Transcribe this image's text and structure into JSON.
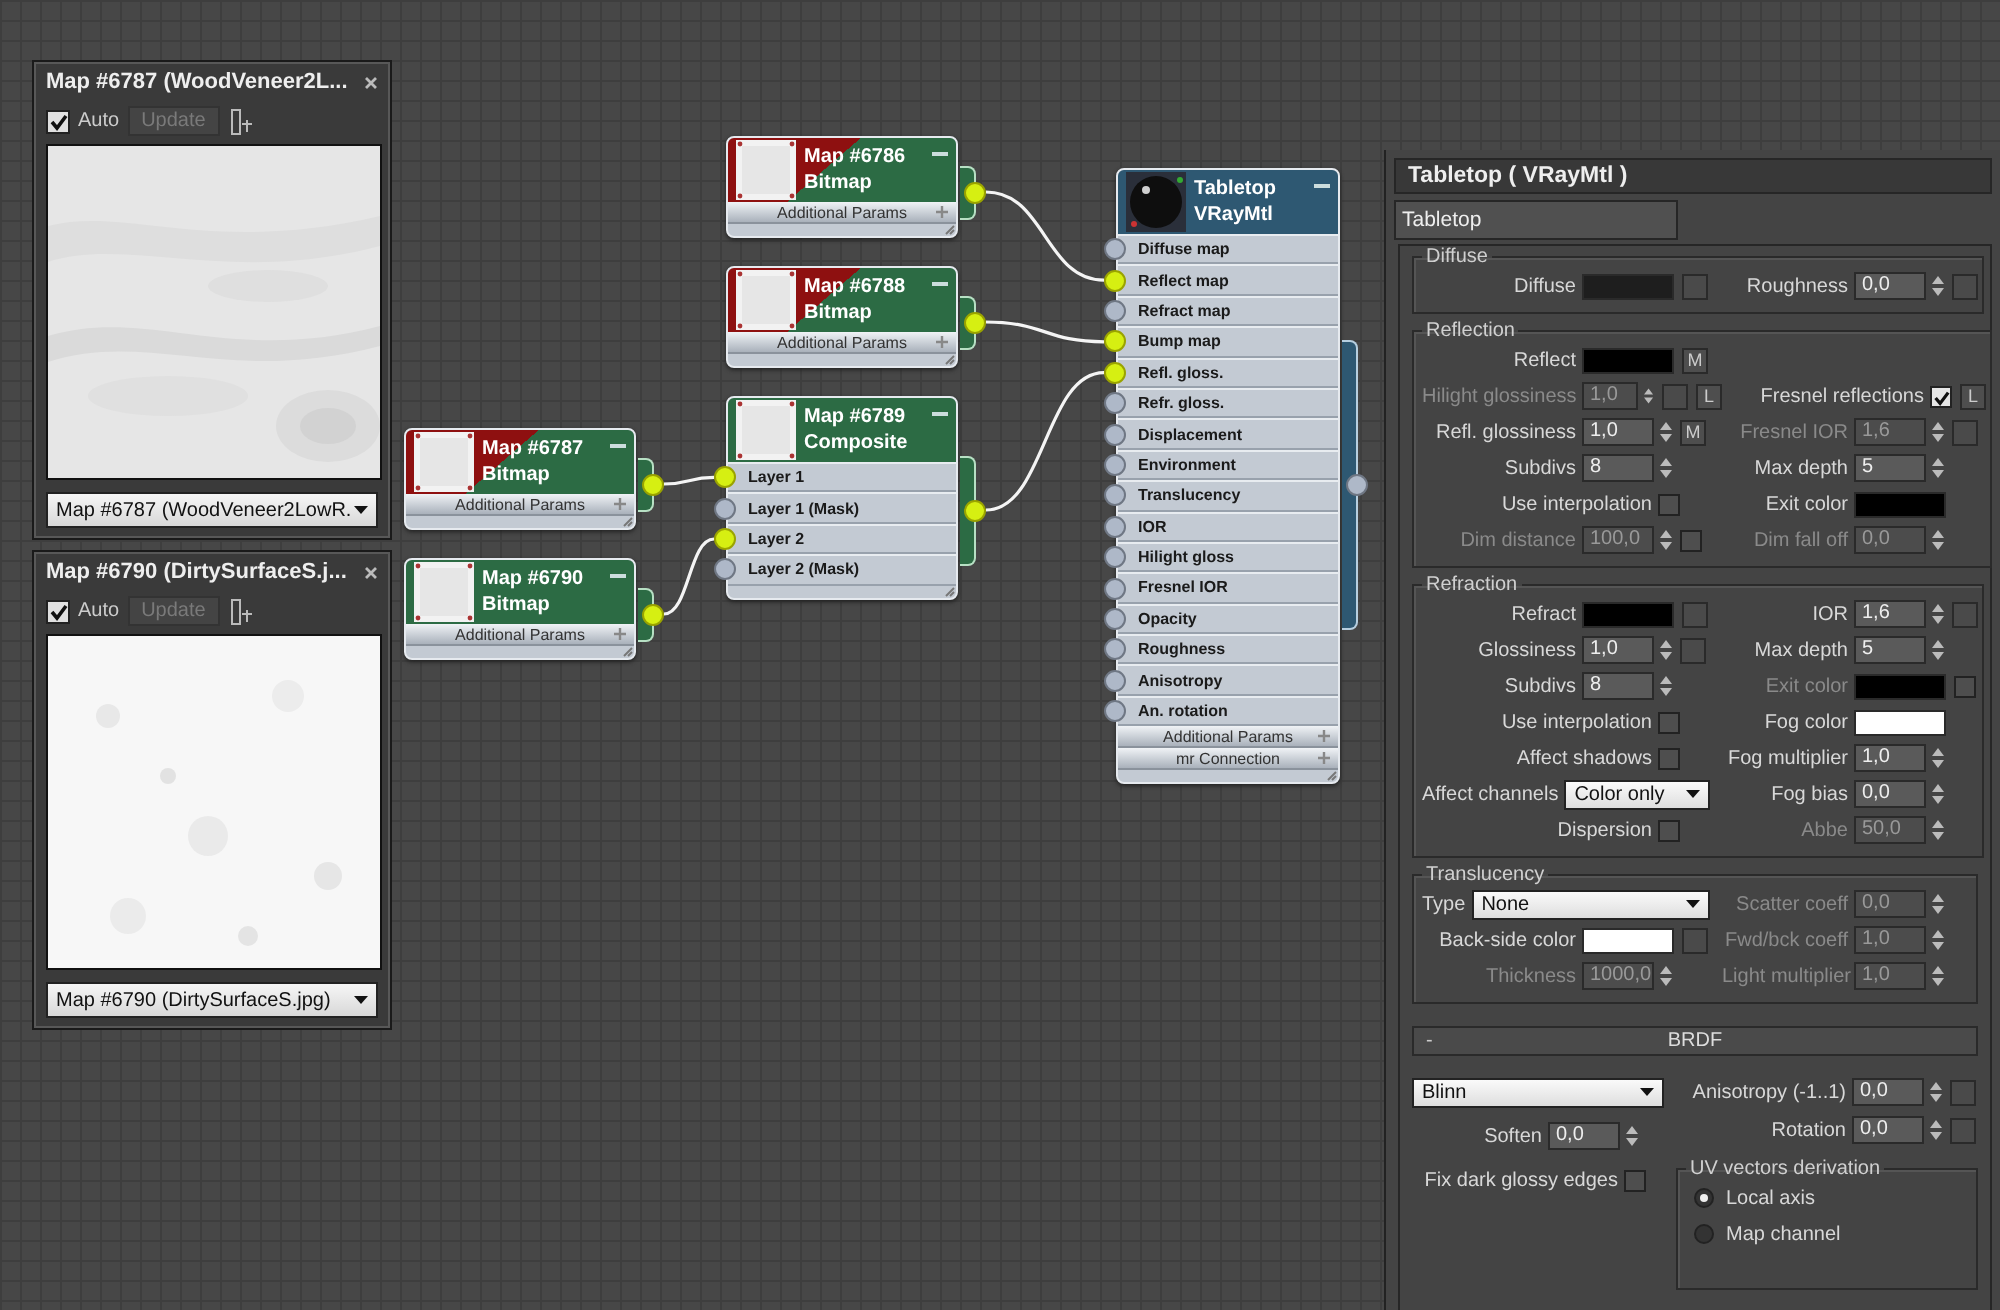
{
  "previews": [
    {
      "title": "Map #6787 (WoodVeneer2L...",
      "auto": {
        "label": "Auto",
        "checked": true
      },
      "update": "Update",
      "map_name": "Map #6787 (WoodVeneer2LowR."
    },
    {
      "title": "Map #6790 (DirtySurfaceS.j...",
      "auto": {
        "label": "Auto",
        "checked": true
      },
      "update": "Update",
      "map_name": "Map #6790 (DirtySurfaceS.jpg)"
    }
  ],
  "nodes": [
    {
      "kind": "map",
      "title": "Map #6786",
      "type": "Bitmap",
      "viewport_shown": true,
      "output_connected": true,
      "rollouts": [
        "Additional Params"
      ]
    },
    {
      "kind": "map",
      "title": "Map #6788",
      "type": "Bitmap",
      "viewport_shown": true,
      "output_connected": true,
      "rollouts": [
        "Additional Params"
      ]
    },
    {
      "kind": "map",
      "title": "Map #6787",
      "type": "Bitmap",
      "viewport_shown": true,
      "output_connected": true,
      "rollouts": [
        "Additional Params"
      ]
    },
    {
      "kind": "map",
      "title": "Map #6790",
      "type": "Bitmap",
      "viewport_shown": false,
      "output_connected": true,
      "rollouts": [
        "Additional Params"
      ]
    },
    {
      "kind": "map",
      "title": "Map #6789",
      "type": "Composite",
      "viewport_shown": false,
      "output_connected": true,
      "slots": [
        {
          "label": "Layer 1",
          "connected": true
        },
        {
          "label": "Layer 1 (Mask)",
          "connected": false
        },
        {
          "label": "Layer 2",
          "connected": true
        },
        {
          "label": "Layer 2 (Mask)",
          "connected": false
        }
      ]
    },
    {
      "kind": "material",
      "title": "Tabletop",
      "type": "VRayMtl",
      "viewport_shown": false,
      "output_connected": false,
      "slots": [
        {
          "label": "Diffuse map",
          "connected": false
        },
        {
          "label": "Reflect map",
          "connected": true
        },
        {
          "label": "Refract map",
          "connected": false
        },
        {
          "label": "Bump map",
          "connected": true
        },
        {
          "label": "Refl. gloss.",
          "connected": true
        },
        {
          "label": "Refr. gloss.",
          "connected": false
        },
        {
          "label": "Displacement",
          "connected": false
        },
        {
          "label": "Environment",
          "connected": false
        },
        {
          "label": "Translucency",
          "connected": false
        },
        {
          "label": "IOR",
          "connected": false
        },
        {
          "label": "Hilight gloss",
          "connected": false
        },
        {
          "label": "Fresnel IOR",
          "connected": false
        },
        {
          "label": "Opacity",
          "connected": false
        },
        {
          "label": "Roughness",
          "connected": false
        },
        {
          "label": "Anisotropy",
          "connected": false
        },
        {
          "label": "An. rotation",
          "connected": false
        }
      ],
      "rollouts": [
        "Additional Params",
        "mr Connection"
      ]
    }
  ],
  "editor": {
    "title": "Tabletop ( VRayMtl )",
    "name_field": "Tabletop",
    "groups": [
      {
        "title": "Diffuse",
        "rows": [
          {
            "left": {
              "kind": "color",
              "label": "Diffuse",
              "color": "#1e1e1e",
              "map_slot": true
            },
            "right": {
              "kind": "spinner",
              "label": "Roughness",
              "value": "0,0",
              "map_slot": true
            }
          }
        ]
      },
      {
        "title": "Reflection",
        "rows": [
          {
            "left": {
              "kind": "color",
              "label": "Reflect",
              "color": "#000000",
              "button": "M"
            }
          },
          {
            "left": {
              "kind": "spinner",
              "label": "Hilight glossiness",
              "value": "1,0",
              "disabled": true,
              "map_slot": true,
              "button": "L"
            },
            "right": {
              "kind": "checkbox",
              "label": "Fresnel reflections",
              "checked": true,
              "button": "L"
            }
          },
          {
            "left": {
              "kind": "spinner",
              "label": "Refl. glossiness",
              "value": "1,0",
              "button": "M"
            },
            "right": {
              "kind": "spinner",
              "label": "Fresnel IOR",
              "value": "1,6",
              "disabled": true,
              "map_slot": true
            }
          },
          {
            "left": {
              "kind": "spinner",
              "label": "Subdivs",
              "value": "8"
            },
            "right": {
              "kind": "spinner",
              "label": "Max depth",
              "value": "5"
            }
          },
          {
            "left": {
              "kind": "checkbox",
              "label": "Use interpolation",
              "checked": false
            },
            "right": {
              "kind": "color",
              "label": "Exit color",
              "color": "#000000"
            }
          },
          {
            "left": {
              "kind": "spinner",
              "label": "Dim distance",
              "value": "100,0",
              "disabled": true,
              "toggle": false
            },
            "right": {
              "kind": "spinner",
              "label": "Dim fall off",
              "value": "0,0",
              "disabled": true
            }
          }
        ]
      },
      {
        "title": "Refraction",
        "rows": [
          {
            "left": {
              "kind": "color",
              "label": "Refract",
              "color": "#000000",
              "map_slot": true
            },
            "right": {
              "kind": "spinner",
              "label": "IOR",
              "value": "1,6",
              "map_slot": true
            }
          },
          {
            "left": {
              "kind": "spinner",
              "label": "Glossiness",
              "value": "1,0",
              "map_slot": true
            },
            "right": {
              "kind": "spinner",
              "label": "Max depth",
              "value": "5"
            }
          },
          {
            "left": {
              "kind": "spinner",
              "label": "Subdivs",
              "value": "8"
            },
            "right": {
              "kind": "color",
              "label": "Exit color",
              "color": "#000000",
              "disabled": true,
              "toggle": false
            }
          },
          {
            "left": {
              "kind": "checkbox",
              "label": "Use interpolation",
              "checked": false
            },
            "right": {
              "kind": "color",
              "label": "Fog color",
              "color": "#ffffff"
            }
          },
          {
            "left": {
              "kind": "checkbox",
              "label": "Affect shadows",
              "checked": false
            },
            "right": {
              "kind": "spinner",
              "label": "Fog multiplier",
              "value": "1,0"
            }
          },
          {
            "left": {
              "kind": "dropdown",
              "label": "Affect channels",
              "value": "Color only"
            },
            "right": {
              "kind": "spinner",
              "label": "Fog bias",
              "value": "0,0"
            }
          },
          {
            "left": {
              "kind": "checkbox",
              "label": "Dispersion",
              "checked": false
            },
            "right": {
              "kind": "spinner",
              "label": "Abbe",
              "value": "50,0",
              "disabled": true
            }
          }
        ]
      },
      {
        "title": "Translucency",
        "rows": [
          {
            "left": {
              "kind": "dropdown",
              "label": "Type",
              "value": "None"
            },
            "right": {
              "kind": "spinner",
              "label": "Scatter coeff",
              "value": "0,0",
              "disabled": true
            }
          },
          {
            "left": {
              "kind": "color",
              "label": "Back-side color",
              "color": "#ffffff",
              "map_slot": true
            },
            "right": {
              "kind": "spinner",
              "label": "Fwd/bck coeff",
              "value": "1,0",
              "disabled": true
            }
          },
          {
            "left": {
              "kind": "spinner",
              "label": "Thickness",
              "value": "1000,0",
              "disabled": true
            },
            "right": {
              "kind": "spinner",
              "label": "Light multiplier",
              "value": "1,0",
              "disabled": true
            }
          }
        ]
      }
    ],
    "brdf": {
      "collapse": "-",
      "title": "BRDF",
      "left": [
        {
          "kind": "dropdown",
          "value": "Blinn"
        },
        {
          "kind": "spinner",
          "label": "Soften",
          "value": "0,0"
        },
        {
          "kind": "checkbox",
          "label": "Fix dark glossy edges",
          "checked": false
        }
      ],
      "right": [
        {
          "kind": "spinner",
          "label": "Anisotropy (-1..1)",
          "value": "0,0",
          "map_slot": true
        },
        {
          "kind": "spinner",
          "label": "Rotation",
          "value": "0,0",
          "map_slot": true
        }
      ],
      "uv_group": {
        "title": "UV vectors derivation",
        "options": [
          {
            "label": "Local axis",
            "selected": true
          },
          {
            "label": "Map channel",
            "selected": false
          }
        ]
      }
    }
  }
}
